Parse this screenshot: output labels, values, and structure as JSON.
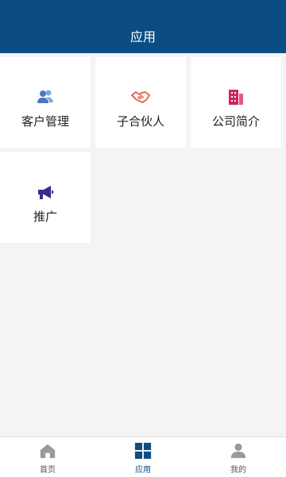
{
  "header": {
    "title": "应用"
  },
  "apps": [
    {
      "label": "客户管理",
      "icon": "users-icon",
      "color": "#4a78c8"
    },
    {
      "label": "子合伙人",
      "icon": "handshake-icon",
      "color": "#e06a5a"
    },
    {
      "label": "公司简介",
      "icon": "building-icon",
      "color": "#d0245a"
    },
    {
      "label": "推广",
      "icon": "megaphone-icon",
      "color": "#3c2b8a"
    }
  ],
  "tabbar": {
    "items": [
      {
        "label": "首页",
        "icon": "home-icon",
        "active": false
      },
      {
        "label": "应用",
        "icon": "apps-grid-icon",
        "active": true
      },
      {
        "label": "我的",
        "icon": "profile-icon",
        "active": false
      }
    ]
  },
  "colors": {
    "primary": "#0b4c85",
    "background": "#f4f4f4",
    "tile": "#ffffff"
  }
}
